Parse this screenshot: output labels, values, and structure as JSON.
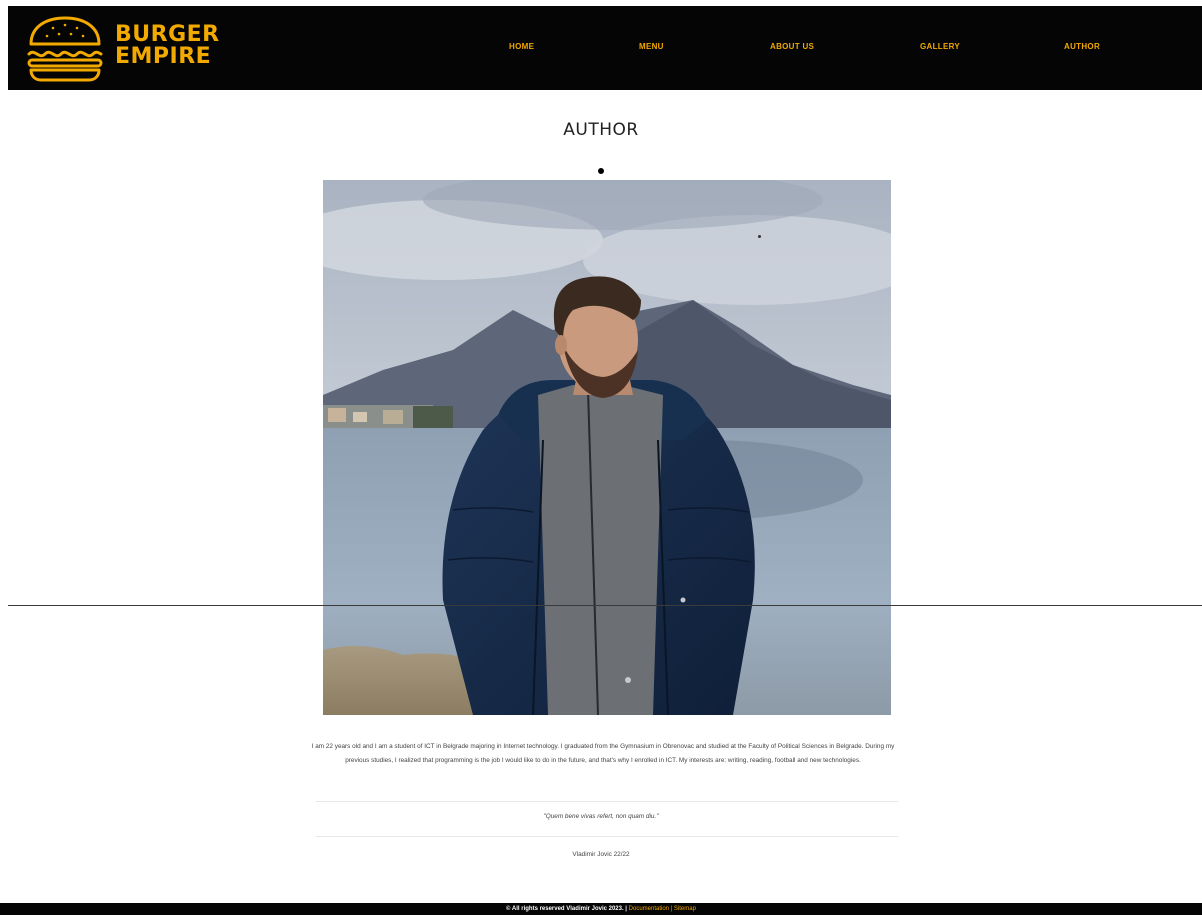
{
  "logo": {
    "line1": "BURGER",
    "line2": "EMPIRE",
    "icon": "burger-icon"
  },
  "nav": {
    "items": [
      "HOME",
      "MENU",
      "ABOUT US",
      "GALLERY",
      "AUTHOR"
    ]
  },
  "page": {
    "title": "AUTHOR"
  },
  "photo": {
    "subject": "author-portrait"
  },
  "bio": {
    "text": "I am 22 years old and I am a student of ICT in Belgrade majoring in Internet technology. I graduated from the Gymnasium in Obrenovac and studied at the Faculty of Political Sciences in Belgrade. During my previous studies, I realized that programming is the job I would like to do in the future, and that's why I enrolled in ICT. My interests are: writing, reading, football and new technologies.",
    "quote": "\"Quem bene vivas refert, non quam diu.\"",
    "signature": "Vladimir Jovic 22/22"
  },
  "footer": {
    "copyright": "© All rights reserved Vladimir Jovic 2023. |",
    "documentation": "Documentation",
    "divider": " | ",
    "sitemap": "Sitemap"
  },
  "colors": {
    "brand": "#f2a900",
    "header_bg": "#050505"
  }
}
